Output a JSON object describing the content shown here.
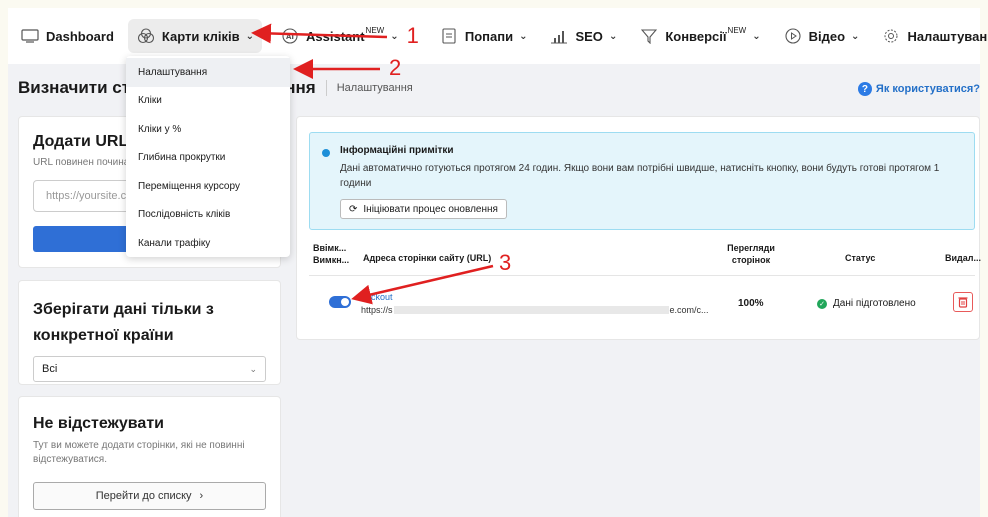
{
  "nav": {
    "dashboard": "Dashboard",
    "click_maps": "Карти кліків",
    "assistant": "Assistant",
    "assistant_badge": "NEW",
    "popups": "Попапи",
    "seo": "SEO",
    "conversions": "Конверсії",
    "conversions_badge": "NEW",
    "video": "Відео",
    "settings": "Налаштування"
  },
  "dropdown": {
    "items": [
      "Налаштування",
      "Кліки",
      "Кліки у %",
      "Глибина прокрутки",
      "Переміщення курсору",
      "Послідовність кліків",
      "Канали трафіку"
    ]
  },
  "page": {
    "title_prefix": "Визначити сто",
    "title_suffix": "ння",
    "breadcrumb": "Налаштування",
    "help": "Як користуватися?"
  },
  "add_url": {
    "title": "Додати URL-а",
    "hint": "URL повинен почина",
    "placeholder": "https://yoursite.cor"
  },
  "country": {
    "title": "Зберігати дані тільки з конкретної країни",
    "selected": "Всі"
  },
  "no_track": {
    "title": "Не відстежувати",
    "desc": "Тут ви можете додати сторінки, які не повинні відстежуватися.",
    "button": "Перейти до списку"
  },
  "info": {
    "title": "Інформаційні примітки",
    "text": "Дані автоматично готуються протягом 24 годин. Якщо вони вам потрібні швидше, натисніть кнопку, вони будуть готові протягом 1 години",
    "button": "Ініціювати процес оновлення"
  },
  "table": {
    "col_toggle": "Ввімк... Вимкн...",
    "col_url": "Адреса сторінки сайту (URL)",
    "col_views": "Перегляди сторінок",
    "col_status": "Статус",
    "col_delete": "Видал...",
    "row": {
      "name": "heckout",
      "url_start": "https://s",
      "url_end": "e.com/c...",
      "views": "100%",
      "status": "Дані підготовлено"
    }
  },
  "annotations": {
    "n1": "1",
    "n2": "2",
    "n3": "3",
    "color": "#e02020"
  }
}
